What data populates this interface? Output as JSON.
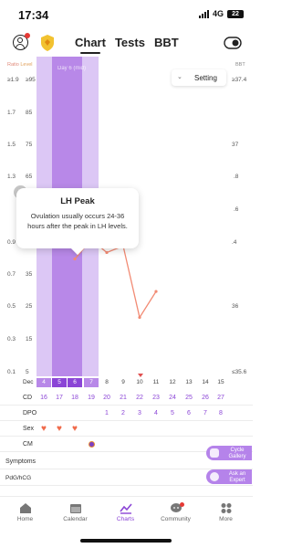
{
  "status": {
    "time": "17:34",
    "network": "4G",
    "battery": "22"
  },
  "header": {
    "tabs": [
      {
        "label": "Chart",
        "active": true
      },
      {
        "label": "Tests",
        "active": false
      },
      {
        "label": "BBT",
        "active": false
      }
    ]
  },
  "chart": {
    "axis_left_head_1": "Ratio",
    "axis_left_head_2": "Level",
    "axis_right_head": "BBT",
    "ratio_ticks": [
      "≥1.9",
      "1.7",
      "1.5",
      "1.3",
      "",
      "0.9",
      "0.7",
      "0.5",
      "0.3",
      "0.1"
    ],
    "level_ticks": [
      "≥95",
      "85",
      "75",
      "65",
      "",
      "45",
      "35",
      "25",
      "15",
      "5"
    ],
    "bbt_ticks": [
      "≥37.4",
      "",
      "37",
      "",
      "",
      "",
      ".4",
      "36",
      "",
      "≤35.6"
    ],
    "bbt_partial": [
      ".8",
      ".6"
    ],
    "period_label": "Day 6 (mid)",
    "setting_label": "Setting",
    "tooltip": {
      "title": "LH Peak",
      "body": "Ovulation usually occurs 24-36 hours after the peak in LH levels."
    }
  },
  "chart_data": {
    "type": "line",
    "title": "",
    "xlabel": "",
    "ylabel": "Ratio",
    "x": [
      "Dec 6",
      "Dec 7",
      "Dec 8",
      "Dec 9",
      "Dec 10",
      "Dec 11"
    ],
    "series": [
      {
        "values": [
          0.8,
          0.92,
          0.84,
          0.88,
          0.44,
          0.6
        ]
      }
    ],
    "peak_index": 1,
    "ylim": [
      0.1,
      1.9
    ],
    "grid": false
  },
  "dates": {
    "month": "Dec",
    "days": [
      "4",
      "5",
      "6",
      "7",
      "8",
      "9",
      "10",
      "11",
      "12",
      "13",
      "14",
      "15"
    ]
  },
  "rows": {
    "cd_label": "CD",
    "cd": [
      "16",
      "17",
      "18",
      "19",
      "20",
      "21",
      "22",
      "23",
      "24",
      "25",
      "26",
      "27"
    ],
    "dpo_label": "DPO",
    "dpo": [
      "",
      "",
      "",
      "",
      "1",
      "2",
      "3",
      "4",
      "5",
      "6",
      "7",
      "8"
    ],
    "sex_label": "Sex",
    "sex_symbol": "♥",
    "cm_label": "CM",
    "symptoms_label": "Symptoms",
    "pdg_label": "PdG/hCG"
  },
  "fabs": {
    "gallery": "Cycle Gallery",
    "expert": "Ask an Expert"
  },
  "nav": [
    {
      "label": "Home",
      "icon": "home-icon"
    },
    {
      "label": "Calendar",
      "icon": "calendar-icon"
    },
    {
      "label": "Charts",
      "icon": "charts-icon"
    },
    {
      "label": "Community",
      "icon": "community-icon"
    },
    {
      "label": "More",
      "icon": "more-icon"
    }
  ],
  "colors": {
    "accent": "#8b45d6",
    "period_shade": "#dcc7f5",
    "period_dark": "#b888e8",
    "line": "#f28b74",
    "heart": "#f06a4a"
  }
}
